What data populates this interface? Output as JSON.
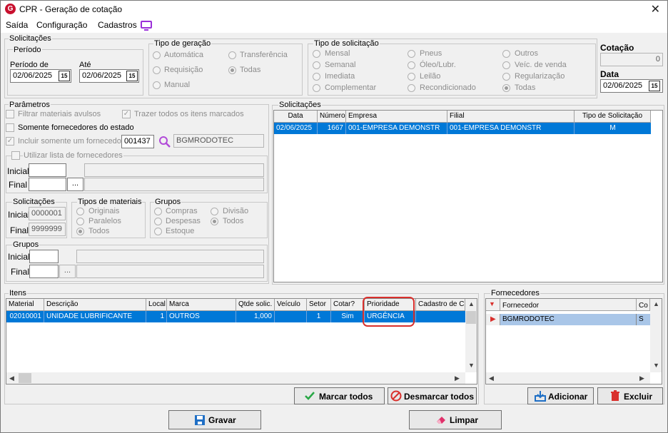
{
  "window": {
    "title": "CPR - Geração de cotação"
  },
  "menu": [
    "Saída",
    "Configuração",
    "Cadastros"
  ],
  "solicitacoes_top": {
    "legend": "Solicitações",
    "periodo_legend": "Período",
    "periodo_de_label": "Período de",
    "periodo_de_value": "02/06/2025",
    "ate_label": "Até",
    "ate_value": "02/06/2025"
  },
  "tipo_geracao": {
    "legend": "Tipo de geração",
    "options": [
      "Automática",
      "Transferência",
      "Requisição",
      "Todas",
      "Manual"
    ],
    "selected": "Todas"
  },
  "tipo_solicitacao": {
    "legend": "Tipo de solicitação",
    "options": [
      "Mensal",
      "Pneus",
      "Outros",
      "Semanal",
      "Óleo/Lubr.",
      "Veíc. de venda",
      "Imediata",
      "Leilão",
      "Regularização",
      "Complementar",
      "Recondicionado",
      "Todas"
    ],
    "selected": "Todas"
  },
  "cotacao": {
    "label": "Cotação",
    "value": "0",
    "data_label": "Data",
    "data_value": "02/06/2025"
  },
  "parametros": {
    "legend": "Parâmetros",
    "filtrar": "Filtrar materiais avulsos",
    "trazer": "Trazer todos os itens marcados",
    "somente_fornecedores": "Somente fornecedores do estado",
    "incluir": "Incluir somente um fornecedor",
    "fornecedor_code": "001437",
    "fornecedor_name": "BGMRODOTEC",
    "utilizar": "Utilizar lista de fornecedores",
    "inicial": "Inicial",
    "final": "Final",
    "ellipsis": "..."
  },
  "sol_range": {
    "legend": "Solicitações",
    "inicial_label": "Inicial",
    "inicial_value": "0000001",
    "final_label": "Final",
    "final_value": "9999999"
  },
  "tipos_materiais": {
    "legend": "Tipos de materiais",
    "options": [
      "Originais",
      "Paralelos",
      "Todos"
    ],
    "selected": "Todos"
  },
  "grupos_radio": {
    "legend": "Grupos",
    "options": [
      "Compras",
      "Divisão",
      "Despesas",
      "Todos",
      "Estoque"
    ],
    "selected": "Todos"
  },
  "grupos_range": {
    "legend": "Grupos",
    "inicial": "Inicial",
    "final": "Final",
    "ellipsis": "..."
  },
  "solicitacoes_grid": {
    "legend": "Solicitações",
    "columns": [
      "Data",
      "Número",
      "Empresa",
      "Filial",
      "Tipo de Solicitação"
    ],
    "rows": [
      [
        "02/06/2025",
        "1667",
        "001-EMPRESA DEMONSTR",
        "001-EMPRESA DEMONSTR",
        "M"
      ]
    ]
  },
  "itens_grid": {
    "legend": "Itens",
    "columns": [
      "Material",
      "Descrição",
      "Local",
      "Marca",
      "Qtde solic.",
      "Veículo",
      "Setor",
      "Cotar?",
      "Prioridade",
      "Cadastro de C..."
    ],
    "rows": [
      [
        "02010001",
        "UNIDADE LUBRIFICANTE",
        "1",
        "OUTROS",
        "1,000",
        "",
        "1",
        "Sim",
        "URGÊNCIA",
        ""
      ]
    ]
  },
  "fornecedores_grid": {
    "legend": "Fornecedores",
    "columns": [
      "Fornecedor",
      "Co"
    ],
    "rows": [
      [
        "BGMRODOTEC",
        "S"
      ]
    ]
  },
  "buttons": {
    "marcar": "Marcar todos",
    "desmarcar": "Desmarcar todos",
    "adicionar": "Adicionar",
    "excluir": "Excluir",
    "gravar": "Gravar",
    "limpar": "Limpar"
  },
  "colors": {
    "selection": "#0078d7",
    "highlight_ring": "#d9302c",
    "accent_icon": "#9b30d9"
  }
}
